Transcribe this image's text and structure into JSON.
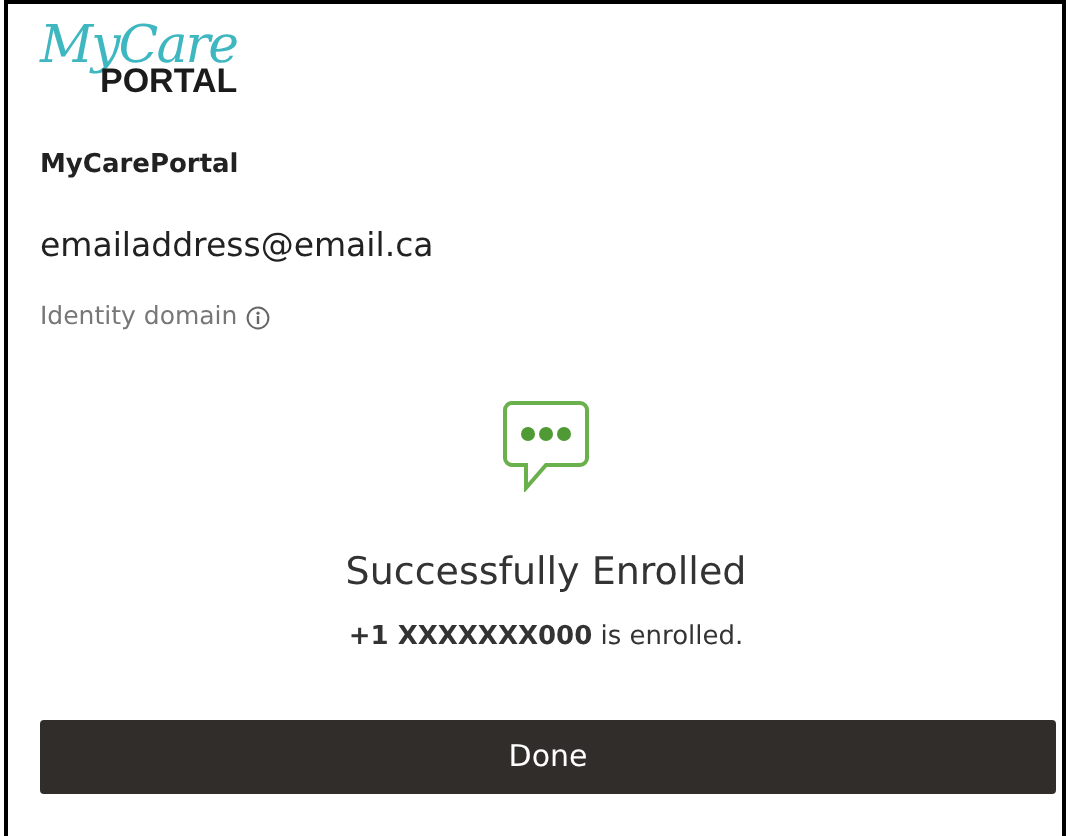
{
  "logo": {
    "script_text": "MyCare",
    "word_text": "PORTAL"
  },
  "app_name": "MyCarePortal",
  "email": "emailaddress@email.ca",
  "identity_domain": {
    "label": "Identity domain"
  },
  "status": {
    "title": "Successfully Enrolled",
    "message": "**+1 XXXXXXX000** is enrolled."
  },
  "buttons": [
    {
      "label": "Done",
      "kind": "primary"
    }
  ]
}
